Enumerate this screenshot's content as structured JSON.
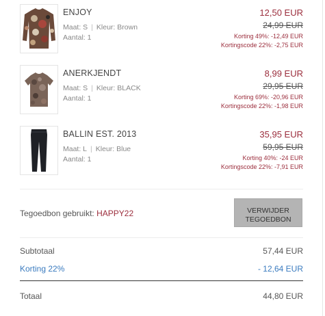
{
  "items": [
    {
      "name": "ENJOY",
      "size_label": "Maat: S",
      "color_label": "Kleur: Brown",
      "qty_label": "Aantal: 1",
      "price_new": "12,50 EUR",
      "price_old": "24,99 EUR",
      "discount": "Korting 49%: -12,49 EUR",
      "code_discount": "Kortingscode 22%: -2,75 EUR"
    },
    {
      "name": "ANERKJENDT",
      "size_label": "Maat: S",
      "color_label": "Kleur: BLACK",
      "qty_label": "Aantal: 1",
      "price_new": "8,99 EUR",
      "price_old": "29,95 EUR",
      "discount": "Korting 69%: -20,96 EUR",
      "code_discount": "Kortingscode 22%: -1,98 EUR"
    },
    {
      "name": "BALLIN EST. 2013",
      "size_label": "Maat: L",
      "color_label": "Kleur: Blue",
      "qty_label": "Aantal: 1",
      "price_new": "35,95 EUR",
      "price_old": "59,95 EUR",
      "discount": "Korting 40%: -24 EUR",
      "code_discount": "Kortingscode 22%: -7,91 EUR"
    }
  ],
  "voucher": {
    "label": "Tegoedbon gebruikt:",
    "code": "HAPPY22",
    "remove_line1": "VERWIJDER",
    "remove_line2": "TEGOEDBON"
  },
  "summary": {
    "subtotal_label": "Subtotaal",
    "subtotal_value": "57,44 EUR",
    "discount_label": "Korting 22%",
    "discount_value": "- 12,64 EUR",
    "total_label": "Totaal",
    "total_value": "44,80 EUR"
  },
  "colors": {
    "accent_red": "#9b2d3c",
    "discount_blue": "#3a7bbf",
    "button_gray": "#b4b4b4"
  },
  "icons": [
    "shirt-floral-longsleeve-image",
    "tshirt-camo-image",
    "pants-black-image"
  ]
}
